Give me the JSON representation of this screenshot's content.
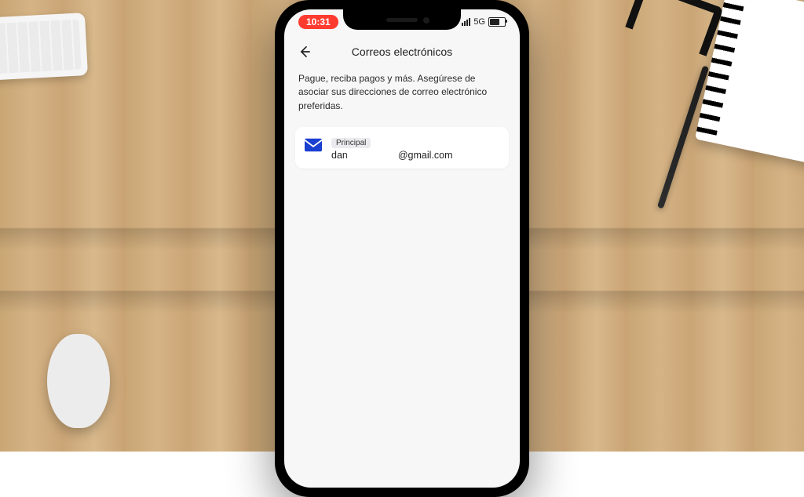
{
  "statusbar": {
    "time": "10:31",
    "network": "5G"
  },
  "header": {
    "title": "Correos electrónicos"
  },
  "description": "Pague, reciba pagos y más. Asegúrese de asociar sus direcciones de correo electrónico preferidas.",
  "email_card": {
    "badge": "Principal",
    "email_prefix": "dan",
    "email_suffix": "@gmail.com"
  },
  "colors": {
    "accent_mail": "#1a3fd1",
    "time_pill": "#ff3b30"
  }
}
